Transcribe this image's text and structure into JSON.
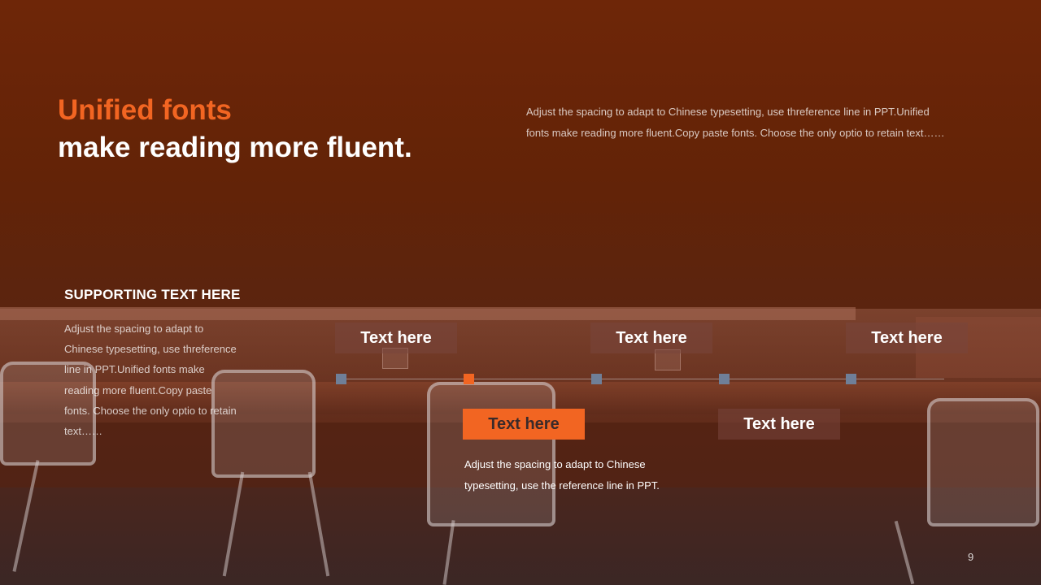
{
  "title": {
    "line1": "Unified fonts",
    "line2": "make reading more fluent."
  },
  "intro_text": "Adjust the spacing to adapt to Chinese typesetting, use threference line in PPT.Unified fonts make reading more fluent.Copy paste fonts. Choose the only optio to retain text……",
  "supporting": {
    "heading": "SUPPORTING TEXT HERE",
    "body": "Adjust the spacing to adapt to Chinese typesetting, use threference line in PPT.Unified fonts make reading more fluent.Copy paste fonts. Choose the only optio to retain text……"
  },
  "timeline": {
    "top_labels": [
      "Text here",
      "Text here",
      "Text here"
    ],
    "bottom_labels": [
      "Text here",
      "Text here"
    ],
    "active_description": "Adjust the spacing to adapt to Chinese typesetting, use the reference line in PPT."
  },
  "colors": {
    "accent": "#f26522",
    "node": "#6f7f98"
  },
  "page_number": "9"
}
